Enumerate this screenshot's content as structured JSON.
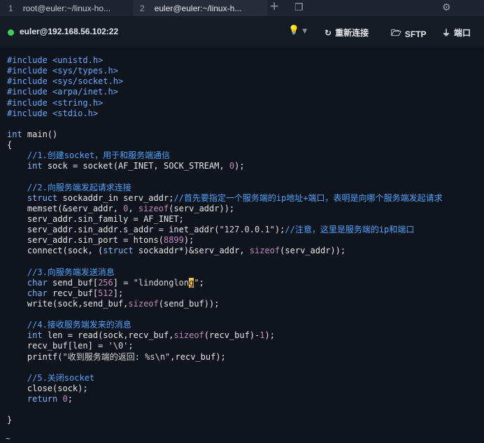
{
  "tabs": [
    {
      "num": "1",
      "label": "root@euler:~/linux-ho..."
    },
    {
      "num": "2",
      "label": "euler@euler:~/linux-h..."
    }
  ],
  "tab_icons": {
    "add": "plus-icon",
    "split": "window-icon",
    "settings": "gear-icon"
  },
  "connection": {
    "host": "euler@192.168.56.102:22",
    "reconnect_label": "重新连接",
    "sftp_label": "SFTP",
    "port_label": "端口"
  },
  "colors": {
    "accent": "#4da3ff",
    "status_online": "#3fcf5e",
    "cursor": "#f2c14e"
  },
  "code": {
    "l1": "#include <unistd.h>",
    "l2": "#include <sys/types.h>",
    "l3": "#include <sys/socket.h>",
    "l4": "#include <arpa/inet.h>",
    "l5": "#include <string.h>",
    "l6": "#include <stdio.h>",
    "c1": "    //1.创建socket，用于和服务端通信",
    "c2": "    //2.向服务端发起请求连接",
    "c2b": "//首先要指定一个服务端的ip地址+端口，表明是向哪个服务端发起请求",
    "c2c": "//注意，这里是服务端的ip和端口",
    "c3": "    //3.向服务端发送消息",
    "c4": "    //4.接收服务端发来的消息",
    "c5": "    //5.关闭socket",
    "str_send": "\"lindonglon",
    "str_send_cursor": "g",
    "str_send_end": "\"",
    "str_ip": "\"127.0.0.1\"",
    "str_fmt": "\"收到服务端的返回: %s\\n\"",
    "str_nul": "'\\0'"
  },
  "prompt": "~"
}
